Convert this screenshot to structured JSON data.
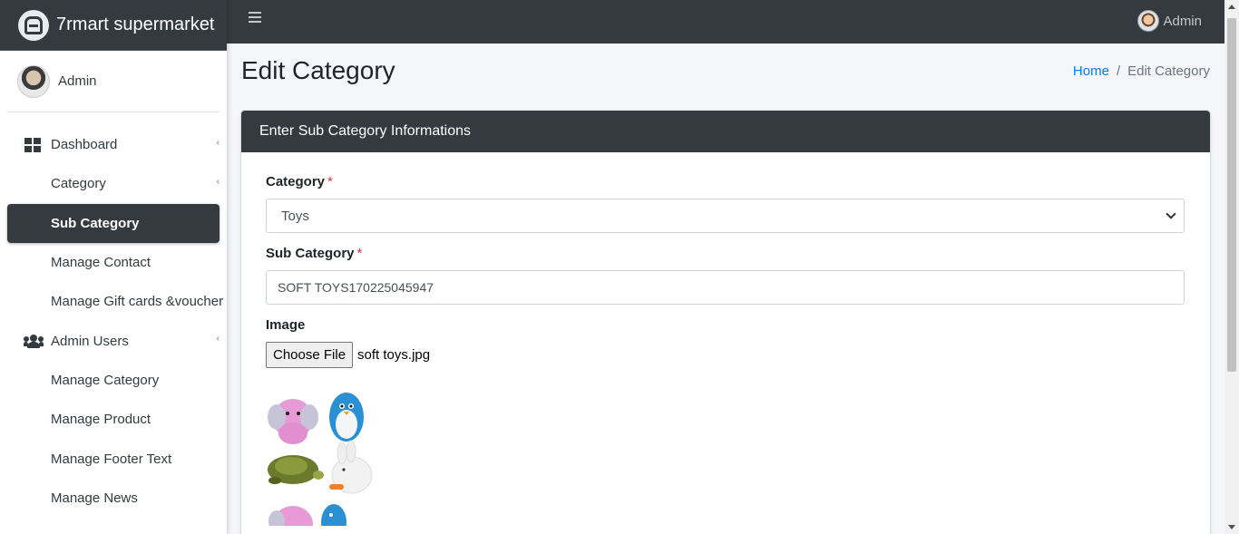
{
  "brand": {
    "name": "7rmart supermarket",
    "logo_icon": "brand-logo-icon"
  },
  "sidebar": {
    "user": {
      "name": "Admin"
    },
    "items": [
      {
        "label": "Dashboard",
        "icon": "dashboard-grid-icon",
        "caret": "‹"
      },
      {
        "label": "Category",
        "caret": "‹"
      },
      {
        "label": "Sub Category"
      },
      {
        "label": "Manage Contact"
      },
      {
        "label": "Manage Gift cards &voucher"
      },
      {
        "label": "Admin Users",
        "icon": "users-icon",
        "caret": "‹"
      },
      {
        "label": "Manage Category"
      },
      {
        "label": "Manage Product"
      },
      {
        "label": "Manage Footer Text"
      },
      {
        "label": "Manage News"
      }
    ]
  },
  "topbar": {
    "user_name": "Admin",
    "menu_icon": "hamburger-icon"
  },
  "header": {
    "title": "Edit Category"
  },
  "breadcrumb": {
    "home": "Home",
    "separator": "/",
    "current": "Edit Category"
  },
  "card": {
    "title": "Enter Sub Category Informations",
    "fields": {
      "category": {
        "label": "Category",
        "required_mark": "*",
        "value": "Toys"
      },
      "sub_category": {
        "label": "Sub Category",
        "required_mark": "*",
        "value": "SOFT TOYS170225045947"
      },
      "image": {
        "label": "Image",
        "button_label": "Choose File",
        "file_name": "soft toys.jpg"
      }
    }
  },
  "colors": {
    "dark": "#343a40",
    "link": "#007bff",
    "required": "#dc3545",
    "background": "#f4f6f9"
  }
}
